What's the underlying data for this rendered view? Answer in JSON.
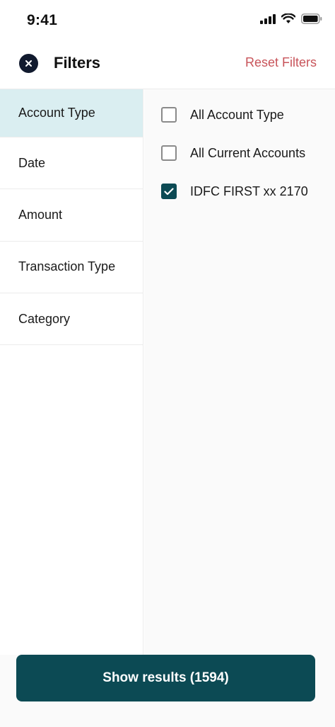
{
  "status_bar": {
    "time": "9:41"
  },
  "header": {
    "title": "Filters",
    "reset_label": "Reset Filters"
  },
  "sidebar": {
    "items": [
      {
        "label": "Account Type"
      },
      {
        "label": "Date"
      },
      {
        "label": "Amount"
      },
      {
        "label": "Transaction Type"
      },
      {
        "label": "Category"
      }
    ],
    "selected": "Account Type"
  },
  "options": {
    "items": [
      {
        "label": "All Account Type",
        "checked": false
      },
      {
        "label": "All Current Accounts",
        "checked": false
      },
      {
        "label": "IDFC FIRST xx 2170",
        "checked": true
      }
    ]
  },
  "footer": {
    "button_label": "Show results (1594)"
  },
  "colors": {
    "accent": "#0c4a54",
    "selected_bg": "#daeef1",
    "reset_link": "#c8545a",
    "close_button": "#111a2e"
  },
  "icons": [
    "signal-icon",
    "wifi-icon",
    "battery-icon",
    "close-icon",
    "checkmark-icon"
  ]
}
